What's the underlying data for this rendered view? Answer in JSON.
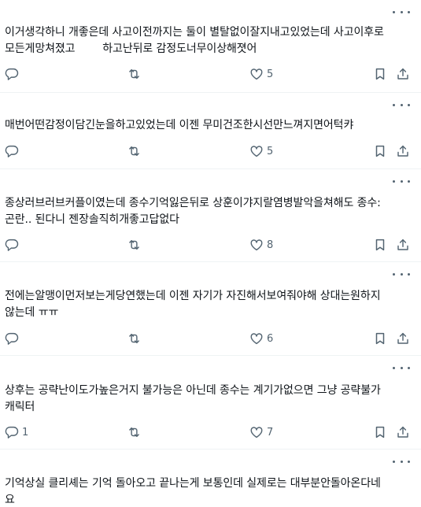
{
  "posts": [
    {
      "text": "이거생각하니 개좋은데 사고이전까지는 둘이 별탈없이잘지내고있었는데 사고이후로\n모든게망쳐졌고        하고난뒤로 감정도너무이상해졋어",
      "replies": "",
      "retweets": "",
      "likes": "5"
    },
    {
      "text": "매번어떤감정이담긴눈을하고있었는데 이젠 무미건조한시선만느껴지면어턱캬",
      "replies": "",
      "retweets": "",
      "likes": "5"
    },
    {
      "text": "종상러브러브커플이였는데 종수기억잃은뒤로 상훈이갸지랄염병발악을쳐해도 종수:\n곤란.. 된다니 젠장솔직히개좋고답없다",
      "replies": "",
      "retweets": "",
      "likes": "8"
    },
    {
      "text": "전에는알맹이먼저보는게당연했는데 이젠 자기가 자진해서보여줘야해 상대는원하지\n않는데 ㅠㅠ",
      "replies": "",
      "retweets": "",
      "likes": "6"
    },
    {
      "text": "상후는 공략난이도가높은거지 불가능은 아닌데 종수는 계기가없으면 그냥 공략불가\n캐릭터",
      "replies": "1",
      "retweets": "",
      "likes": "7"
    },
    {
      "text": "기억상실 클리셰는 기억 돌아오고 끝나는게 보통인데 실제로는 대부분안돌아온다네\n요",
      "replies": "",
      "retweets": "",
      "likes": ""
    }
  ],
  "icons": {
    "more": "more-horizontal-icon",
    "reply": "reply-icon",
    "retweet": "retweet-icon",
    "like": "heart-icon",
    "bookmark": "bookmark-icon",
    "share": "share-icon"
  },
  "colors": {
    "text": "#0f1419",
    "icon": "#536471",
    "divider": "#eff3f4"
  }
}
